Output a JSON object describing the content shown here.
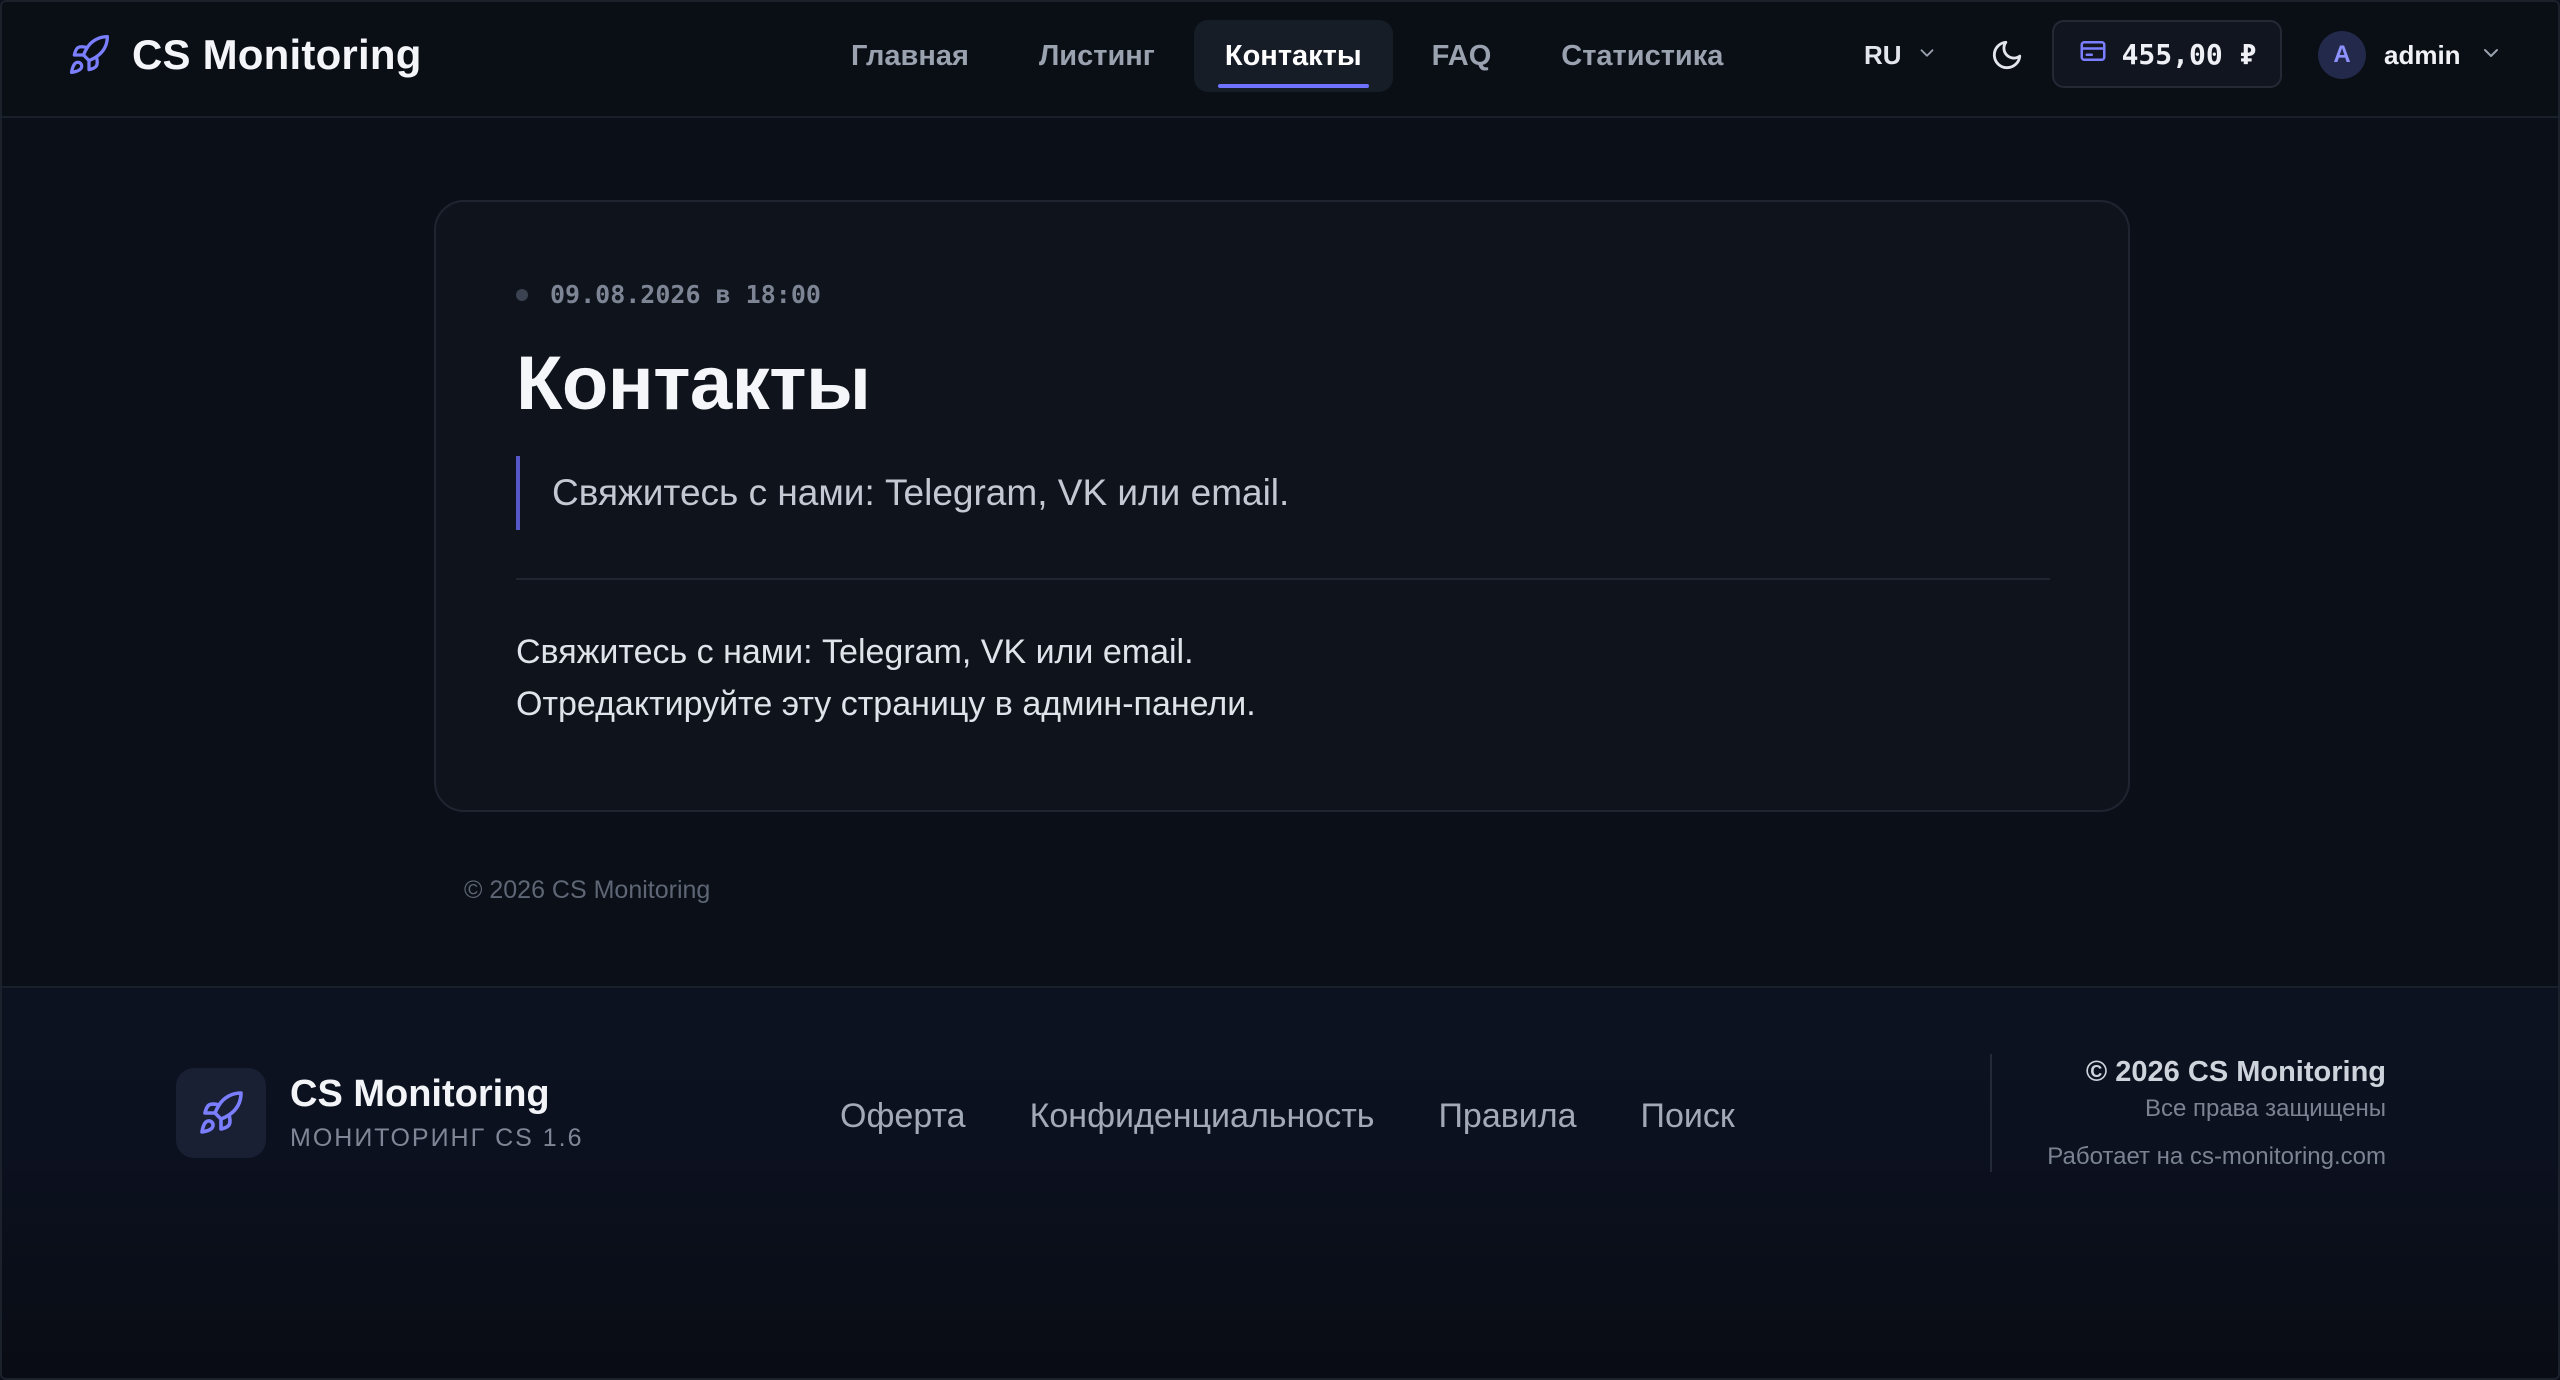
{
  "app": {
    "title": "CS Monitoring"
  },
  "nav": {
    "items": [
      {
        "label": "Главная",
        "active": false
      },
      {
        "label": "Листинг",
        "active": false
      },
      {
        "label": "Контакты",
        "active": true
      },
      {
        "label": "FAQ",
        "active": false
      },
      {
        "label": "Статистика",
        "active": false
      }
    ]
  },
  "header": {
    "language": "RU",
    "balance": "455,00 ₽",
    "user": {
      "initial": "A",
      "name": "admin"
    }
  },
  "content": {
    "date": "09.08.2026 в 18:00",
    "title": "Контакты",
    "quote": "Свяжитесь с нами: Telegram, VK или email.",
    "body_line_1": "Свяжитесь с нами: Telegram, VK или email.",
    "body_line_2": "Отредактируйте эту страницу в админ-панели.",
    "copyright": "© 2026 CS Monitoring"
  },
  "footer": {
    "name": "CS Monitoring",
    "subtitle": "МОНИТОРИНГ CS 1.6",
    "links": [
      "Оферта",
      "Конфиденциальность",
      "Правила",
      "Поиск"
    ],
    "copyright": "© 2026 CS Monitoring",
    "rights": "Все права защищены",
    "powered": "Работает на cs-monitoring.com"
  },
  "colors": {
    "accent": "#6f72ff",
    "background": "#0b0f17",
    "card": "#0f141c"
  },
  "icons": {
    "brand": "rocket-icon",
    "theme": "moon-icon",
    "balance": "wallet-icon",
    "dropdown": "chevron-down-icon"
  }
}
